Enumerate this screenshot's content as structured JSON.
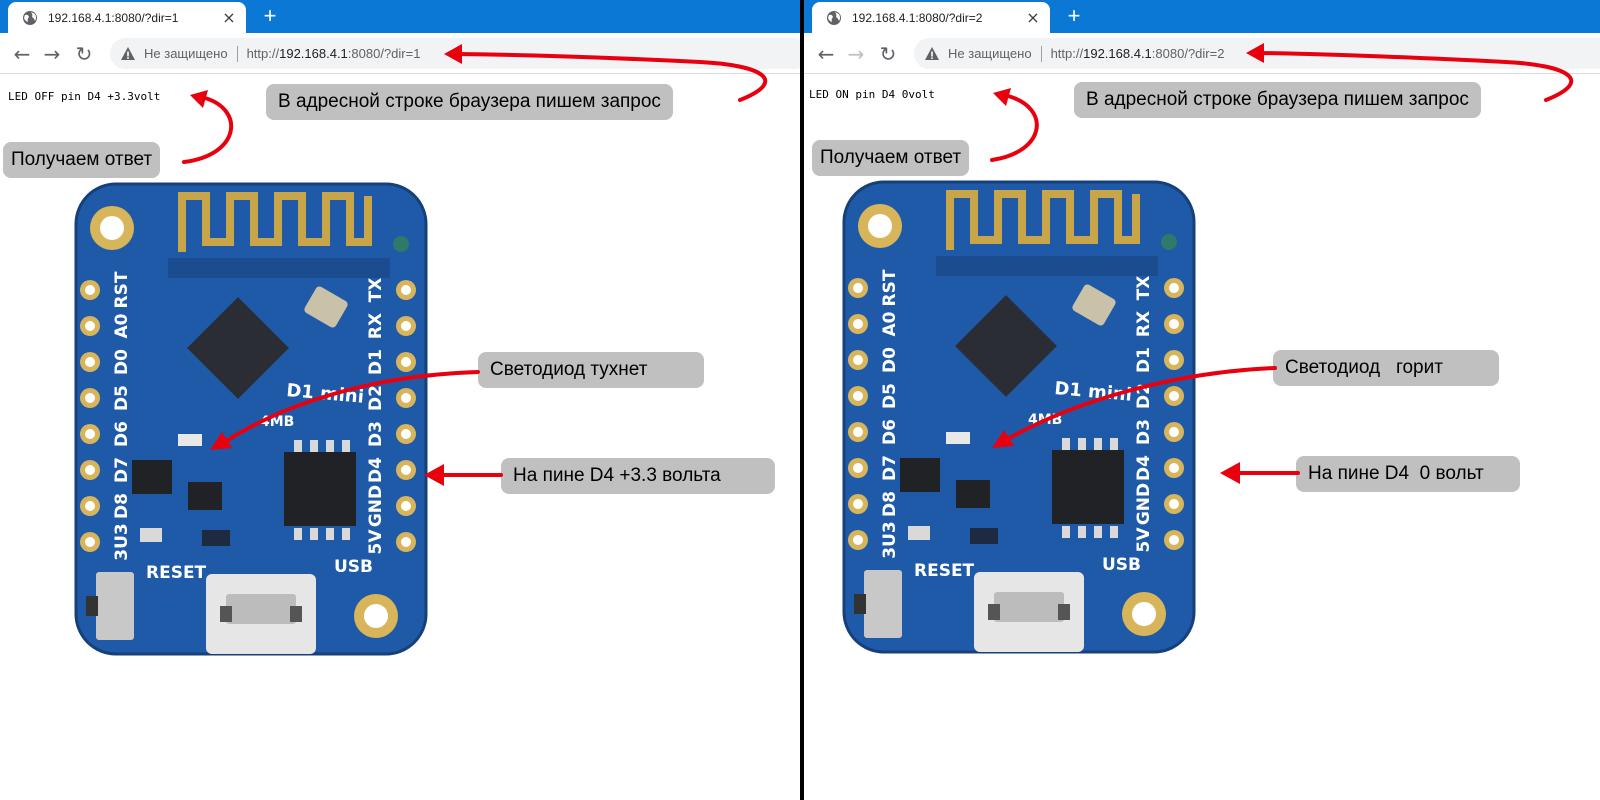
{
  "left": {
    "tab_title": "192.168.4.1:8080/?dir=1",
    "security_label": "Не защищено",
    "url_prefix": "http://",
    "url_host": "192.168.4.1",
    "url_rest": ":8080/?dir=1",
    "response_text": "LED OFF pin D4 +3.3volt",
    "callout_request": "В адресной строке браузера пишем запрос",
    "callout_response": "Получаем ответ",
    "callout_led": "Светодиод тухнет",
    "callout_pin": "На пине D4 +3.3 вольта"
  },
  "right": {
    "tab_title": "192.168.4.1:8080/?dir=2",
    "security_label": "Не защищено",
    "url_prefix": "http://",
    "url_host": "192.168.4.1",
    "url_rest": ":8080/?dir=2",
    "response_text": "LED ON pin D4 0volt",
    "callout_request": "В адресной строке браузера пишем запрос",
    "callout_response": "Получаем ответ",
    "callout_led": "Светодиод   горит",
    "callout_pin": "На пине D4  0 вольт"
  },
  "board": {
    "left_pins": [
      "RST",
      "A0",
      "D0",
      "D5",
      "D6",
      "D7",
      "D8",
      "3U3"
    ],
    "right_pins": [
      "TX",
      "RX",
      "D1",
      "D2",
      "D3",
      "D4",
      "GND",
      "5V"
    ],
    "model_label": "D1 mini",
    "flash_label": "4MB",
    "reset_label": "RESET",
    "usb_label": "USB"
  },
  "icons": {
    "tab_icon": "globe-icon",
    "close_icon": "close-icon",
    "new_tab_icon": "plus-icon",
    "back_icon": "back-arrow-icon",
    "forward_icon": "forward-arrow-icon",
    "reload_icon": "reload-icon",
    "warning_icon": "warning-icon"
  },
  "colors": {
    "tabstrip": "#0a78d4",
    "callout": "#c0c0c0",
    "arrow": "#e8000f",
    "board": "#1f5aa8"
  }
}
